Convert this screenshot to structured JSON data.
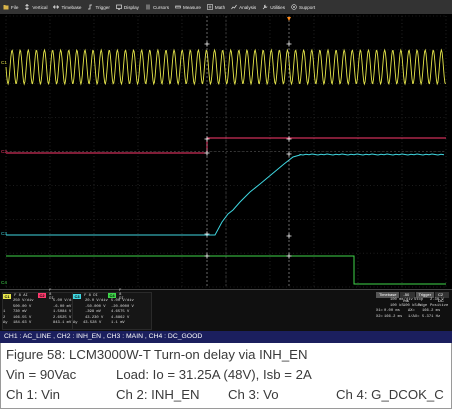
{
  "toolbar": {
    "items": [
      {
        "label": "File",
        "icon": "folder-icon"
      },
      {
        "label": "Vertical",
        "icon": "vertical-icon"
      },
      {
        "label": "Timebase",
        "icon": "timebase-icon"
      },
      {
        "label": "Trigger",
        "icon": "trigger-icon"
      },
      {
        "label": "Display",
        "icon": "display-icon"
      },
      {
        "label": "Cursors",
        "icon": "cursors-icon"
      },
      {
        "label": "Measure",
        "icon": "measure-icon"
      },
      {
        "label": "Math",
        "icon": "math-icon"
      },
      {
        "label": "Analysis",
        "icon": "analysis-icon"
      },
      {
        "label": "Utilities",
        "icon": "utilities-icon"
      },
      {
        "label": "Support",
        "icon": "support-icon"
      }
    ]
  },
  "screen": {
    "colors": {
      "ch1": "#e6e64a",
      "ch2": "#ff3a6e",
      "ch3": "#3fd6e0",
      "ch4": "#3fd64a",
      "grid": "#3a3a3a"
    },
    "tags": {
      "ch1": "C1",
      "ch2": "C2",
      "ch3": "C3",
      "ch4": "C4"
    }
  },
  "readouts": [
    {
      "ch": "C1",
      "color": "#e6e64a",
      "badge_text": "C1",
      "hdr_text": "F 8 AI",
      "rows": [
        [
          "250 V/div",
          "5.00 V/div"
        ],
        [
          "500.00 V",
          "-6.00 mV"
        ],
        [
          "730 mV",
          "1.5084 V"
        ],
        [
          "166.55 V",
          "2.6525 V"
        ],
        [
          "184.63 V",
          "843.1 mV"
        ]
      ],
      "labels": [
        "",
        "",
        "1",
        "2",
        "Δy"
      ]
    },
    {
      "ch": "C2",
      "color": "#ff3a6e",
      "badge_text": "C2",
      "hdr_text": "F 8 DI",
      "rows": [
        [
          "5.00 V/div",
          ""
        ],
        [
          "-6.00 mV",
          ""
        ],
        [
          "1.5084 V",
          ""
        ],
        [
          "2.6525 V",
          ""
        ],
        [
          "843.1 mV",
          ""
        ]
      ],
      "labels": [
        "",
        "",
        "",
        "",
        ""
      ]
    },
    {
      "ch": "C3",
      "color": "#3fd6e0",
      "badge_text": "C3",
      "hdr_text": "F 8 DI",
      "rows": [
        [
          "20.0 V/div",
          "5.00 V/div"
        ],
        [
          "-50.000 V",
          "-20.0000 V"
        ],
        [
          "-398 mV",
          "4.6575 V"
        ],
        [
          "43.230 V",
          "4.8862 V"
        ],
        [
          "43.528 V",
          "1.1 mV"
        ]
      ],
      "labels": [
        "",
        "",
        "",
        "",
        "Δy"
      ]
    },
    {
      "ch": "C4",
      "color": "#3fd64a",
      "badge_text": "C4",
      "hdr_text": "F 8 DI",
      "rows": [
        [
          "5.00 V/div",
          ""
        ],
        [
          "-20.0000 V",
          ""
        ],
        [
          "4.6575 V",
          ""
        ],
        [
          "4.8862 V",
          ""
        ],
        [
          "1.1 mV",
          ""
        ]
      ],
      "labels": [
        "",
        "",
        "",
        "",
        ""
      ]
    }
  ],
  "timebase": {
    "tabs": [
      "Timebase",
      "-50 ms",
      "Trigger"
    ],
    "tab_extra": "C2 DC",
    "lines": [
      [
        "",
        "100 ms/div",
        "Stop",
        "2.30 V"
      ],
      [
        "",
        "100 kS",
        "100 kS/s",
        "Edge",
        "Positive"
      ],
      [
        "X1=",
        "0.00 ms",
        "ΔX=",
        "166.2 ms"
      ],
      [
        "X2=",
        "166.2 ms",
        "1/ΔX=",
        "5.371 Hz"
      ]
    ]
  },
  "legend": {
    "text": "CH1 : AC_LINE , CH2 : INH_EN , CH3 : MAIN , CH4 : DC_GOOD"
  },
  "caption": {
    "line1": "Figure 58:    LCM3000W-T Turn-on delay via INH_EN",
    "line2a": "Vin = 90Vac",
    "line2b": "Load: Io = 31.25A (48V), Isb = 2A",
    "ch1": "Ch 1: Vin",
    "ch2": "Ch 2: INH_EN",
    "ch3": "Ch 3: Vo",
    "ch4": "Ch 4: G_DCOK_C"
  }
}
